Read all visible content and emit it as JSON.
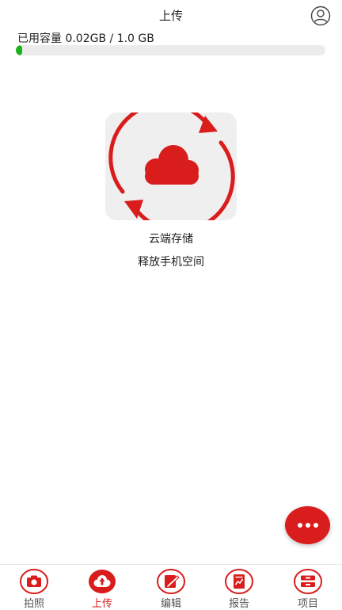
{
  "header": {
    "title": "上传"
  },
  "storage": {
    "label": "已用容量 0.02GB / 1.0 GB",
    "used_fraction": 0.02
  },
  "hero": {
    "title": "云端存储",
    "subtitle": "释放手机空间"
  },
  "tabs": [
    {
      "label": "拍照",
      "icon": "camera-icon"
    },
    {
      "label": "上传",
      "icon": "upload-cloud-icon",
      "active": true
    },
    {
      "label": "编辑",
      "icon": "edit-icon"
    },
    {
      "label": "报告",
      "icon": "report-icon"
    },
    {
      "label": "项目",
      "icon": "project-icon"
    }
  ],
  "colors": {
    "accent": "#d91c1c",
    "progress": "#1bb31b",
    "track": "#ececec",
    "tile": "#efefef"
  }
}
